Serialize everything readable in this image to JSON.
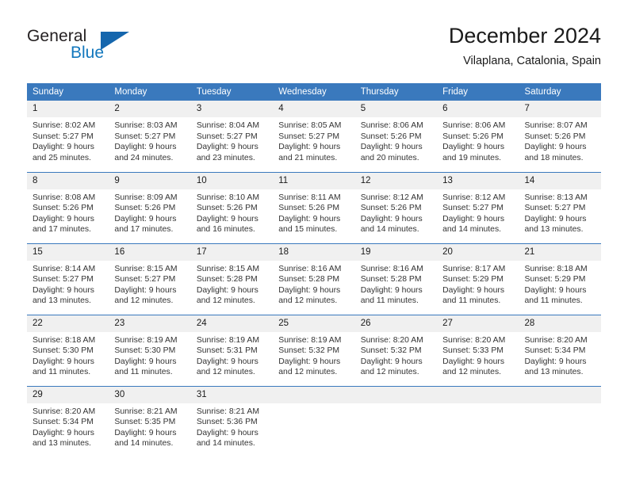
{
  "brand": {
    "name_part1": "General",
    "name_part2": "Blue",
    "logo_icon": "triangle-icon",
    "accent_color": "#1566ad",
    "text_color": "#231f20"
  },
  "header": {
    "title": "December 2024",
    "subtitle": "Vilaplana, Catalonia, Spain"
  },
  "theme": {
    "header_bg": "#3a79bd",
    "header_text": "#ffffff",
    "daynum_bg": "#f0f0f0",
    "cell_bg": "#ffffff",
    "rule_color": "#3a79bd"
  },
  "weekday_headers": [
    "Sunday",
    "Monday",
    "Tuesday",
    "Wednesday",
    "Thursday",
    "Friday",
    "Saturday"
  ],
  "weeks": [
    [
      {
        "day": "1",
        "sunrise": "Sunrise: 8:02 AM",
        "sunset": "Sunset: 5:27 PM",
        "daylight_1": "Daylight: 9 hours",
        "daylight_2": "and 25 minutes."
      },
      {
        "day": "2",
        "sunrise": "Sunrise: 8:03 AM",
        "sunset": "Sunset: 5:27 PM",
        "daylight_1": "Daylight: 9 hours",
        "daylight_2": "and 24 minutes."
      },
      {
        "day": "3",
        "sunrise": "Sunrise: 8:04 AM",
        "sunset": "Sunset: 5:27 PM",
        "daylight_1": "Daylight: 9 hours",
        "daylight_2": "and 23 minutes."
      },
      {
        "day": "4",
        "sunrise": "Sunrise: 8:05 AM",
        "sunset": "Sunset: 5:27 PM",
        "daylight_1": "Daylight: 9 hours",
        "daylight_2": "and 21 minutes."
      },
      {
        "day": "5",
        "sunrise": "Sunrise: 8:06 AM",
        "sunset": "Sunset: 5:26 PM",
        "daylight_1": "Daylight: 9 hours",
        "daylight_2": "and 20 minutes."
      },
      {
        "day": "6",
        "sunrise": "Sunrise: 8:06 AM",
        "sunset": "Sunset: 5:26 PM",
        "daylight_1": "Daylight: 9 hours",
        "daylight_2": "and 19 minutes."
      },
      {
        "day": "7",
        "sunrise": "Sunrise: 8:07 AM",
        "sunset": "Sunset: 5:26 PM",
        "daylight_1": "Daylight: 9 hours",
        "daylight_2": "and 18 minutes."
      }
    ],
    [
      {
        "day": "8",
        "sunrise": "Sunrise: 8:08 AM",
        "sunset": "Sunset: 5:26 PM",
        "daylight_1": "Daylight: 9 hours",
        "daylight_2": "and 17 minutes."
      },
      {
        "day": "9",
        "sunrise": "Sunrise: 8:09 AM",
        "sunset": "Sunset: 5:26 PM",
        "daylight_1": "Daylight: 9 hours",
        "daylight_2": "and 17 minutes."
      },
      {
        "day": "10",
        "sunrise": "Sunrise: 8:10 AM",
        "sunset": "Sunset: 5:26 PM",
        "daylight_1": "Daylight: 9 hours",
        "daylight_2": "and 16 minutes."
      },
      {
        "day": "11",
        "sunrise": "Sunrise: 8:11 AM",
        "sunset": "Sunset: 5:26 PM",
        "daylight_1": "Daylight: 9 hours",
        "daylight_2": "and 15 minutes."
      },
      {
        "day": "12",
        "sunrise": "Sunrise: 8:12 AM",
        "sunset": "Sunset: 5:26 PM",
        "daylight_1": "Daylight: 9 hours",
        "daylight_2": "and 14 minutes."
      },
      {
        "day": "13",
        "sunrise": "Sunrise: 8:12 AM",
        "sunset": "Sunset: 5:27 PM",
        "daylight_1": "Daylight: 9 hours",
        "daylight_2": "and 14 minutes."
      },
      {
        "day": "14",
        "sunrise": "Sunrise: 8:13 AM",
        "sunset": "Sunset: 5:27 PM",
        "daylight_1": "Daylight: 9 hours",
        "daylight_2": "and 13 minutes."
      }
    ],
    [
      {
        "day": "15",
        "sunrise": "Sunrise: 8:14 AM",
        "sunset": "Sunset: 5:27 PM",
        "daylight_1": "Daylight: 9 hours",
        "daylight_2": "and 13 minutes."
      },
      {
        "day": "16",
        "sunrise": "Sunrise: 8:15 AM",
        "sunset": "Sunset: 5:27 PM",
        "daylight_1": "Daylight: 9 hours",
        "daylight_2": "and 12 minutes."
      },
      {
        "day": "17",
        "sunrise": "Sunrise: 8:15 AM",
        "sunset": "Sunset: 5:28 PM",
        "daylight_1": "Daylight: 9 hours",
        "daylight_2": "and 12 minutes."
      },
      {
        "day": "18",
        "sunrise": "Sunrise: 8:16 AM",
        "sunset": "Sunset: 5:28 PM",
        "daylight_1": "Daylight: 9 hours",
        "daylight_2": "and 12 minutes."
      },
      {
        "day": "19",
        "sunrise": "Sunrise: 8:16 AM",
        "sunset": "Sunset: 5:28 PM",
        "daylight_1": "Daylight: 9 hours",
        "daylight_2": "and 11 minutes."
      },
      {
        "day": "20",
        "sunrise": "Sunrise: 8:17 AM",
        "sunset": "Sunset: 5:29 PM",
        "daylight_1": "Daylight: 9 hours",
        "daylight_2": "and 11 minutes."
      },
      {
        "day": "21",
        "sunrise": "Sunrise: 8:18 AM",
        "sunset": "Sunset: 5:29 PM",
        "daylight_1": "Daylight: 9 hours",
        "daylight_2": "and 11 minutes."
      }
    ],
    [
      {
        "day": "22",
        "sunrise": "Sunrise: 8:18 AM",
        "sunset": "Sunset: 5:30 PM",
        "daylight_1": "Daylight: 9 hours",
        "daylight_2": "and 11 minutes."
      },
      {
        "day": "23",
        "sunrise": "Sunrise: 8:19 AM",
        "sunset": "Sunset: 5:30 PM",
        "daylight_1": "Daylight: 9 hours",
        "daylight_2": "and 11 minutes."
      },
      {
        "day": "24",
        "sunrise": "Sunrise: 8:19 AM",
        "sunset": "Sunset: 5:31 PM",
        "daylight_1": "Daylight: 9 hours",
        "daylight_2": "and 12 minutes."
      },
      {
        "day": "25",
        "sunrise": "Sunrise: 8:19 AM",
        "sunset": "Sunset: 5:32 PM",
        "daylight_1": "Daylight: 9 hours",
        "daylight_2": "and 12 minutes."
      },
      {
        "day": "26",
        "sunrise": "Sunrise: 8:20 AM",
        "sunset": "Sunset: 5:32 PM",
        "daylight_1": "Daylight: 9 hours",
        "daylight_2": "and 12 minutes."
      },
      {
        "day": "27",
        "sunrise": "Sunrise: 8:20 AM",
        "sunset": "Sunset: 5:33 PM",
        "daylight_1": "Daylight: 9 hours",
        "daylight_2": "and 12 minutes."
      },
      {
        "day": "28",
        "sunrise": "Sunrise: 8:20 AM",
        "sunset": "Sunset: 5:34 PM",
        "daylight_1": "Daylight: 9 hours",
        "daylight_2": "and 13 minutes."
      }
    ],
    [
      {
        "day": "29",
        "sunrise": "Sunrise: 8:20 AM",
        "sunset": "Sunset: 5:34 PM",
        "daylight_1": "Daylight: 9 hours",
        "daylight_2": "and 13 minutes."
      },
      {
        "day": "30",
        "sunrise": "Sunrise: 8:21 AM",
        "sunset": "Sunset: 5:35 PM",
        "daylight_1": "Daylight: 9 hours",
        "daylight_2": "and 14 minutes."
      },
      {
        "day": "31",
        "sunrise": "Sunrise: 8:21 AM",
        "sunset": "Sunset: 5:36 PM",
        "daylight_1": "Daylight: 9 hours",
        "daylight_2": "and 14 minutes."
      },
      {
        "day": "",
        "sunrise": "",
        "sunset": "",
        "daylight_1": "",
        "daylight_2": ""
      },
      {
        "day": "",
        "sunrise": "",
        "sunset": "",
        "daylight_1": "",
        "daylight_2": ""
      },
      {
        "day": "",
        "sunrise": "",
        "sunset": "",
        "daylight_1": "",
        "daylight_2": ""
      },
      {
        "day": "",
        "sunrise": "",
        "sunset": "",
        "daylight_1": "",
        "daylight_2": ""
      }
    ]
  ]
}
